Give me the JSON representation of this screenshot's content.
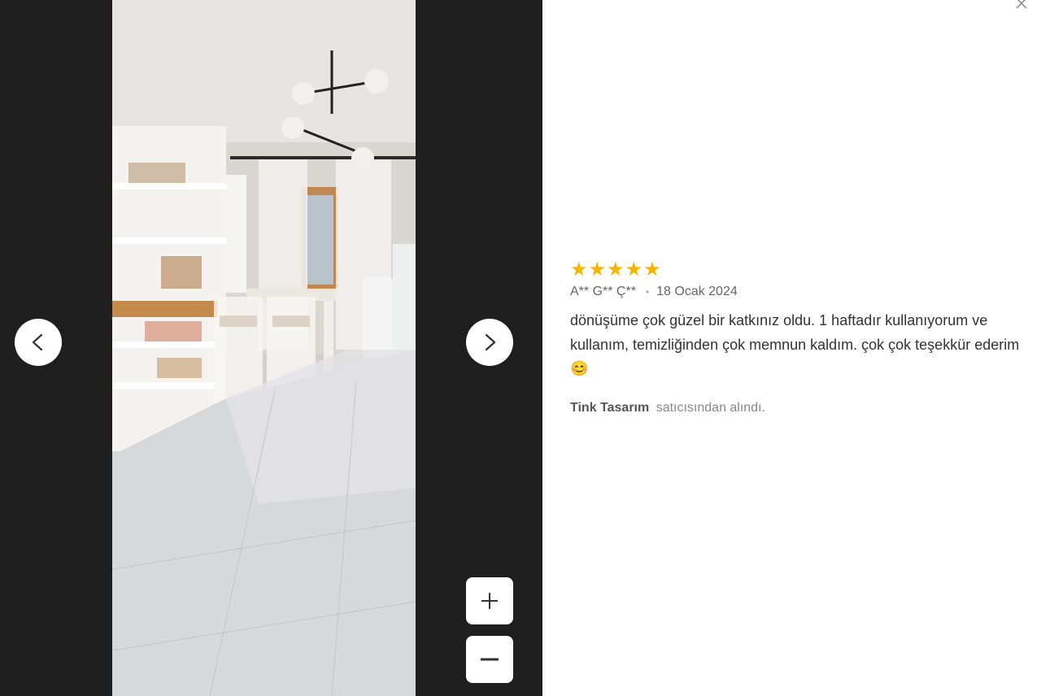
{
  "review": {
    "rating": 5,
    "stars": [
      "★",
      "★",
      "★",
      "★",
      "★"
    ],
    "author": "A** G** Ç**",
    "separator": "•",
    "date": "18 Ocak 2024",
    "comment": "dönüşüme çok güzel bir katkınız oldu. 1 haftadır kullanıyorum ve kullanım, temizliğinden çok memnun kaldım. çok çok teşekkür ederim 😊",
    "seller_name": "Tink Tasarım",
    "seller_suffix": "satıcısından alındı."
  },
  "colors": {
    "star": "#f5b400",
    "viewer_background": "#1e1e1e"
  },
  "icons": {
    "prev": "chevron-left-icon",
    "next": "chevron-right-icon",
    "zoom_in": "plus-icon",
    "zoom_out": "minus-icon",
    "close": "close-icon"
  }
}
